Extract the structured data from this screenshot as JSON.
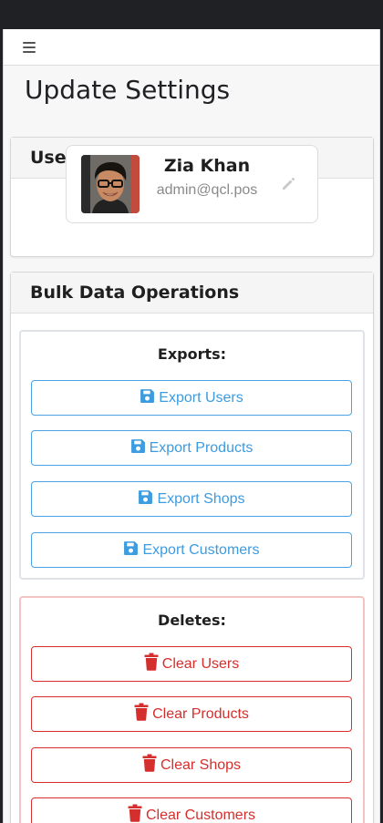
{
  "page": {
    "title": "Update Settings"
  },
  "profile": {
    "header": "User Profile",
    "name": "Zia Khan",
    "email": "admin@qcl.pos"
  },
  "bulk": {
    "header": "Bulk Data Operations",
    "exports": {
      "title": "Exports:",
      "buttons": [
        "Export Users",
        "Export Products",
        "Export Shops",
        "Export Customers"
      ]
    },
    "deletes": {
      "title": "Deletes:",
      "buttons": [
        "Clear Users",
        "Clear Products",
        "Clear Shops",
        "Clear Customers"
      ]
    }
  },
  "colors": {
    "export_accent": "#3d9bdf",
    "delete_accent": "#d42f2c",
    "text": "#1f1f1f",
    "muted": "#8a8a8a"
  },
  "icons": {
    "menu": "hamburger-icon",
    "edit": "pencil-icon",
    "export": "floppy-disk-icon",
    "delete": "trash-icon"
  }
}
